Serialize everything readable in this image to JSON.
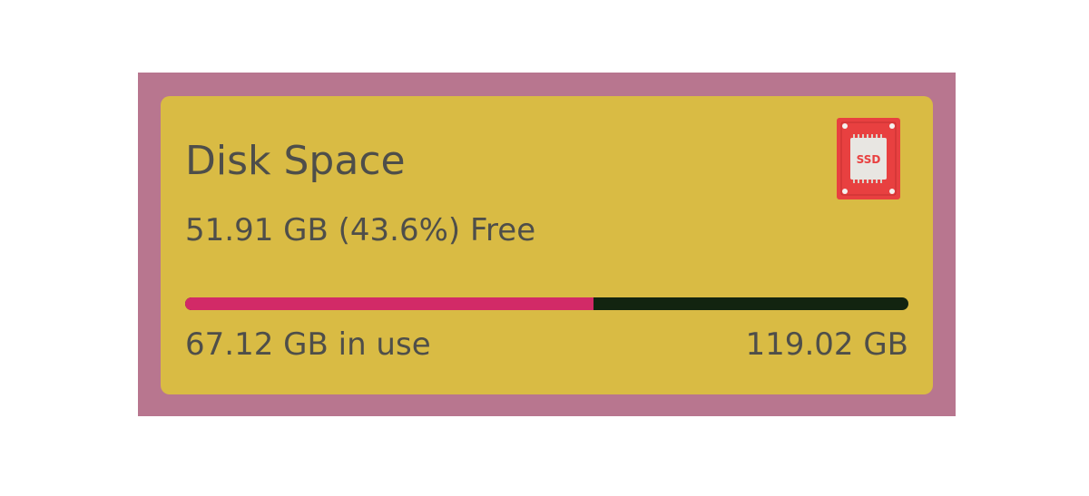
{
  "widget": {
    "title": "Disk Space",
    "free_text": "51.91 GB (43.6%) Free",
    "used_text": "67.12 GB in use",
    "total_text": "119.02 GB",
    "used_fraction": 0.564,
    "icon": "ssd-icon",
    "icon_label": "SSD"
  },
  "colors": {
    "frame_background": "#b8768f",
    "card_background": "#d9bb44",
    "bar_used": "#d22a67",
    "bar_free": "#122410",
    "text": "#4e4e4a",
    "icon_background": "#e84040",
    "icon_chip": "#e8e6e2"
  }
}
